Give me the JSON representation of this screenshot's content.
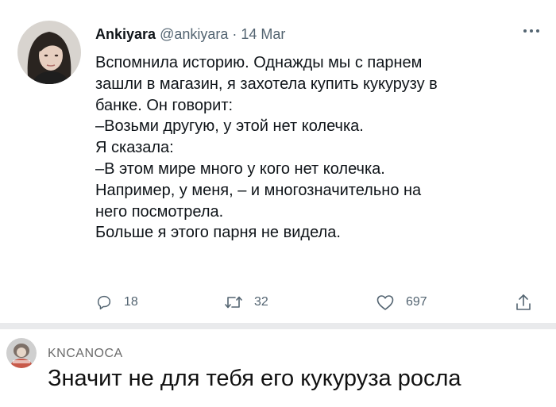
{
  "tweet": {
    "author_name": "Ankiyara",
    "author_handle": "@ankiyara",
    "separator": "·",
    "date": "14 Mar",
    "lines": [
      "Вспомнила историю. Однажды мы с парнем",
      "зашли в магазин, я захотела купить кукурузу в",
      "банке. Он говорит:",
      "–Возьми другую, у этой нет колечка.",
      "Я сказала:",
      "–В этом мире много у кого нет колечка.",
      "Например, у меня, – и многозначительно на",
      "него посмотрела.",
      "Больше я этого парня не видела."
    ],
    "actions": {
      "reply_count": "18",
      "retweet_count": "32",
      "like_count": "697"
    },
    "icons": {
      "more": "more-horizontal-icon",
      "reply": "reply-bubble-icon",
      "retweet": "retweet-icon",
      "like": "heart-icon",
      "share": "share-icon"
    }
  },
  "comment": {
    "author": "KNCANOCA",
    "text": "Значит не для тебя его кукуруза росла"
  },
  "colors": {
    "text_primary": "#0f1419",
    "text_secondary": "#536471",
    "divider": "#e9eaec",
    "comment_author": "#6b6b6b"
  }
}
